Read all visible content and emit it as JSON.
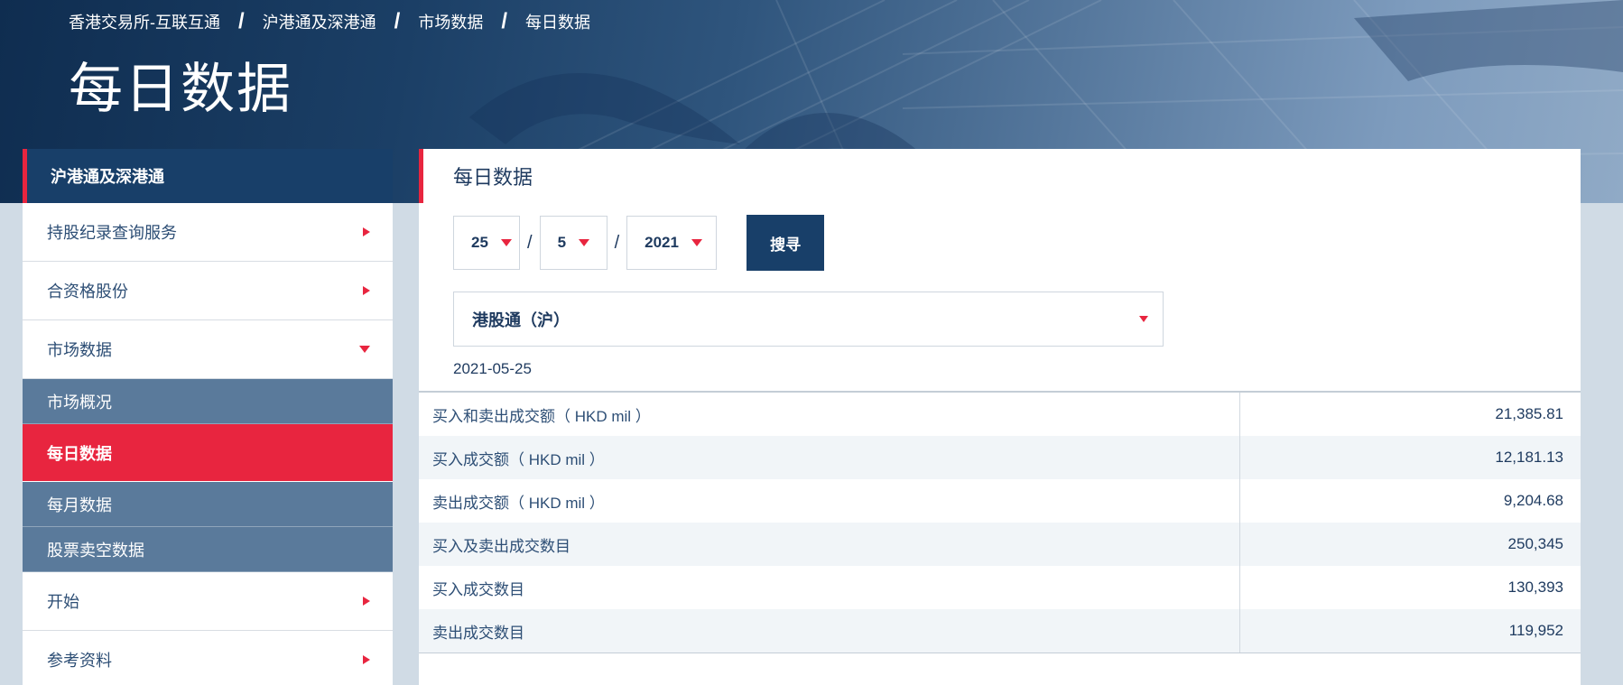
{
  "breadcrumb": [
    "香港交易所-互联互通",
    "沪港通及深港通",
    "市场数据",
    "每日数据"
  ],
  "breadcrumb_sep": "/",
  "page_title": "每日数据",
  "sidebar": {
    "header": "沪港通及深港通",
    "items_top": [
      {
        "label": "持股纪录查询服务",
        "icon": "chevron-right"
      },
      {
        "label": "合资格股份",
        "icon": "chevron-right"
      },
      {
        "label": "市场数据",
        "icon": "chevron-down"
      }
    ],
    "sub_items": [
      {
        "label": "市场概况",
        "active": false
      },
      {
        "label": "每日数据",
        "active": true
      },
      {
        "label": "每月数据",
        "active": false
      },
      {
        "label": "股票卖空数据",
        "active": false
      }
    ],
    "items_bottom": [
      {
        "label": "开始",
        "icon": "chevron-right"
      },
      {
        "label": "参考资料",
        "icon": "chevron-right"
      }
    ]
  },
  "main": {
    "title": "每日数据",
    "day": "25",
    "month": "5",
    "year": "2021",
    "date_sep": "/",
    "search_label": "搜寻",
    "market": "港股通（沪）",
    "date_display": "2021-05-25",
    "rows": [
      {
        "label": "买入和卖出成交额（ HKD mil ）",
        "value": "21,385.81"
      },
      {
        "label": "买入成交额（ HKD mil ）",
        "value": "12,181.13"
      },
      {
        "label": "卖出成交额（ HKD mil ）",
        "value": "9,204.68"
      },
      {
        "label": "买入及卖出成交数目",
        "value": "250,345"
      },
      {
        "label": "买入成交数目",
        "value": "130,393"
      },
      {
        "label": "卖出成交数目",
        "value": "119,952"
      }
    ]
  },
  "colors": {
    "navy": "#183f69",
    "accent_red": "#e8253f",
    "sub_item_bg": "#5a7a9b"
  }
}
